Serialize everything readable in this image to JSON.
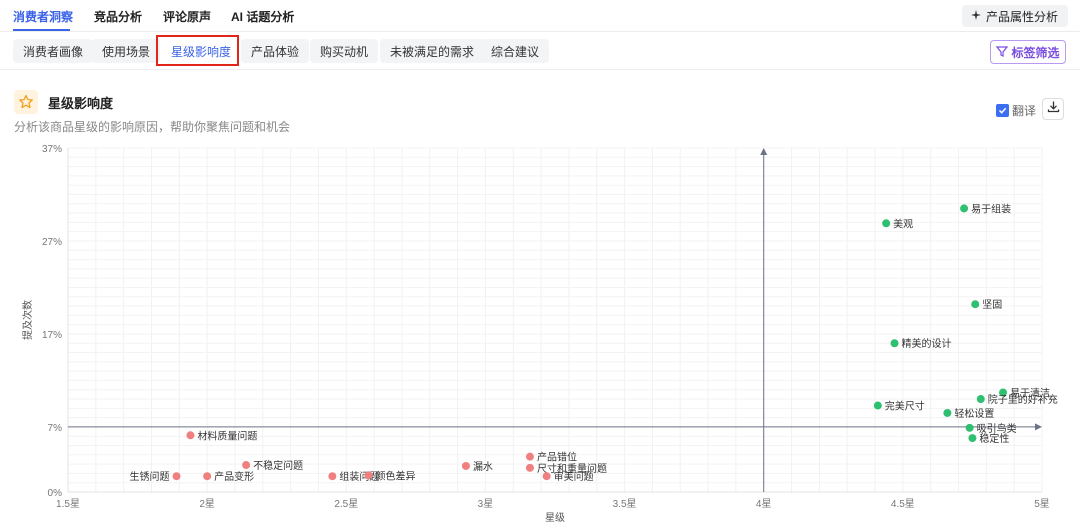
{
  "top_tabs": [
    {
      "label": "消费者洞察",
      "active": true
    },
    {
      "label": "竞品分析",
      "active": false
    },
    {
      "label": "评论原声",
      "active": false
    },
    {
      "label": "AI 话题分析",
      "active": false
    }
  ],
  "attr_button": "产品属性分析",
  "sub_tabs": [
    {
      "label": "消费者画像"
    },
    {
      "label": "使用场景"
    },
    {
      "label": "星级影响度",
      "active": true
    },
    {
      "label": "产品体验"
    },
    {
      "label": "购买动机"
    },
    {
      "label": "未被满足的需求"
    },
    {
      "label": "综合建议"
    }
  ],
  "filter_button": "标签筛选",
  "section": {
    "title": "星级影响度",
    "subtitle": "分析该商品星级的影响原因，帮助你聚焦问题和机会",
    "translate_label": "翻译",
    "translate_checked": true
  },
  "colors": {
    "accent": "#3b63e8",
    "positive": "#2fbf71",
    "negative": "#f08080",
    "highlight": "#e0251b"
  },
  "chart_data": {
    "type": "scatter",
    "xlabel": "星级",
    "ylabel": "提及次数",
    "xlim": [
      1.5,
      5
    ],
    "ylim": [
      0,
      37
    ],
    "x_ticks": [
      "1.5星",
      "2星",
      "2.5星",
      "3星",
      "3.5星",
      "4星",
      "4.5星",
      "5星"
    ],
    "y_ticks": [
      "0%",
      "7%",
      "17%",
      "27%",
      "37%"
    ],
    "y_tick_values": [
      0,
      7,
      17,
      27,
      37
    ],
    "quadrant_x": 4,
    "quadrant_y": 7,
    "points": [
      {
        "label": "易于组装",
        "x": 4.72,
        "y": 30.5,
        "group": "positive"
      },
      {
        "label": "美观",
        "x": 4.44,
        "y": 28.9,
        "group": "positive"
      },
      {
        "label": "坚固",
        "x": 4.76,
        "y": 20.2,
        "group": "positive"
      },
      {
        "label": "精美的设计",
        "x": 4.47,
        "y": 16.0,
        "group": "positive"
      },
      {
        "label": "易于清洁",
        "x": 4.86,
        "y": 10.7,
        "group": "positive"
      },
      {
        "label": "院子里的好补充",
        "x": 4.78,
        "y": 10.0,
        "group": "positive"
      },
      {
        "label": "完美尺寸",
        "x": 4.41,
        "y": 9.3,
        "group": "positive"
      },
      {
        "label": "轻松设置",
        "x": 4.66,
        "y": 8.5,
        "group": "positive"
      },
      {
        "label": "吸引鸟类",
        "x": 4.74,
        "y": 6.9,
        "group": "positive"
      },
      {
        "label": "稳定性",
        "x": 4.75,
        "y": 5.8,
        "group": "positive"
      },
      {
        "label": "材料质量问题",
        "x": 1.94,
        "y": 6.1,
        "group": "negative"
      },
      {
        "label": "不稳定问题",
        "x": 2.14,
        "y": 2.9,
        "group": "negative"
      },
      {
        "label": "生锈问题",
        "x": 1.89,
        "y": 1.7,
        "group": "negative"
      },
      {
        "label": "产品变形",
        "x": 2.0,
        "y": 1.7,
        "group": "negative"
      },
      {
        "label": "组装问题",
        "x": 2.45,
        "y": 1.7,
        "group": "negative"
      },
      {
        "label": "颜色差异",
        "x": 2.58,
        "y": 1.8,
        "group": "negative"
      },
      {
        "label": "漏水",
        "x": 2.93,
        "y": 2.8,
        "group": "negative"
      },
      {
        "label": "产品错位",
        "x": 3.16,
        "y": 3.8,
        "group": "negative"
      },
      {
        "label": "尺寸和重量问题",
        "x": 3.16,
        "y": 2.6,
        "group": "negative"
      },
      {
        "label": "审美问题",
        "x": 3.22,
        "y": 1.7,
        "group": "negative"
      }
    ]
  }
}
